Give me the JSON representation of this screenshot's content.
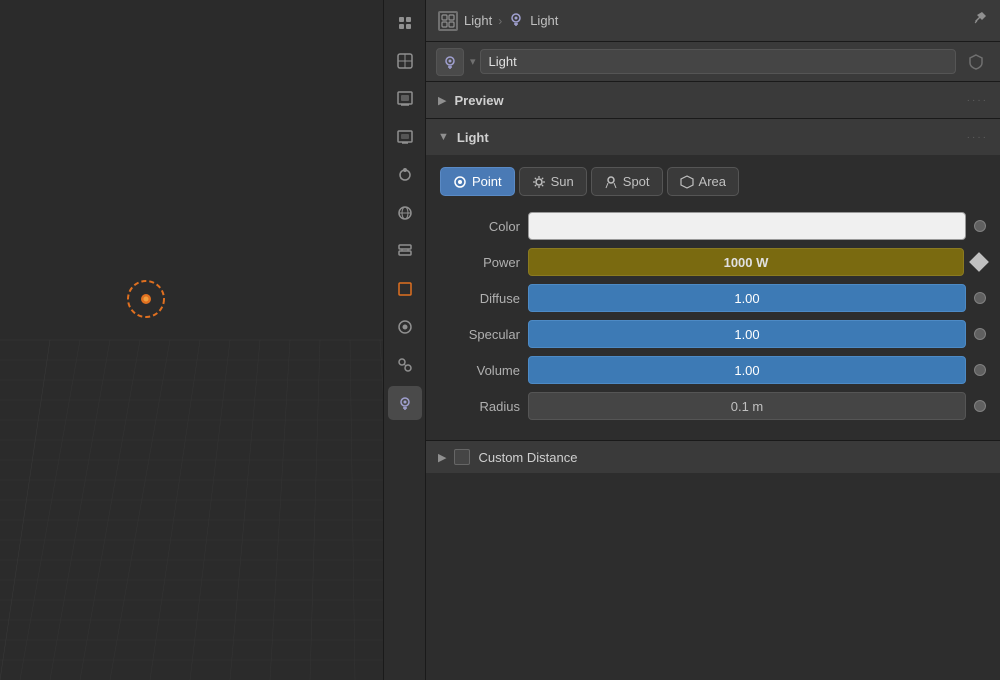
{
  "viewport": {
    "background": "#2b2b2b"
  },
  "header": {
    "breadcrumb_icon_text": "⊞",
    "breadcrumb_object": "Light",
    "breadcrumb_separator": ">",
    "breadcrumb_light_icon": "⊙",
    "breadcrumb_light_name": "Light",
    "pin_icon": "📌"
  },
  "object_selector": {
    "icon_symbol": "⊙",
    "name": "Light",
    "shield_symbol": "🛡"
  },
  "sidebar": {
    "icons": [
      {
        "symbol": "🔧",
        "name": "tools",
        "active": false
      },
      {
        "symbol": "🎒",
        "name": "active-tool",
        "active": false
      },
      {
        "symbol": "🖨",
        "name": "scene",
        "active": false
      },
      {
        "symbol": "🖼",
        "name": "render",
        "active": false
      },
      {
        "symbol": "💧",
        "name": "particles",
        "active": false
      },
      {
        "symbol": "🌐",
        "name": "world",
        "active": false
      },
      {
        "symbol": "🗃",
        "name": "modifier",
        "active": false
      },
      {
        "symbol": "🔲",
        "name": "object",
        "active": false
      },
      {
        "symbol": "🔵",
        "name": "physics",
        "active": false
      },
      {
        "symbol": "🌀",
        "name": "constraints",
        "active": false
      },
      {
        "symbol": "💡",
        "name": "light-data",
        "active": true,
        "orange": true
      }
    ]
  },
  "sections": {
    "preview": {
      "title": "Preview",
      "collapsed": true,
      "arrow": "▶",
      "dots": "····"
    },
    "light": {
      "title": "Light",
      "collapsed": false,
      "arrow": "▼",
      "dots": "····"
    }
  },
  "light_types": [
    {
      "label": "Point",
      "icon": "⊙",
      "active": true
    },
    {
      "label": "Sun",
      "icon": "☀",
      "active": false
    },
    {
      "label": "Spot",
      "icon": "◎",
      "active": false
    },
    {
      "label": "Area",
      "icon": "⬡",
      "active": false
    }
  ],
  "properties": {
    "color": {
      "label": "Color",
      "value": "",
      "type": "white"
    },
    "power": {
      "label": "Power",
      "value": "1000 W",
      "type": "yellow"
    },
    "diffuse": {
      "label": "Diffuse",
      "value": "1.00",
      "type": "blue"
    },
    "specular": {
      "label": "Specular",
      "value": "1.00",
      "type": "blue"
    },
    "volume": {
      "label": "Volume",
      "value": "1.00",
      "type": "blue"
    },
    "radius": {
      "label": "Radius",
      "value": "0.1 m",
      "type": "gray"
    }
  },
  "custom_distance": {
    "label": "Custom Distance",
    "arrow": "▶"
  }
}
